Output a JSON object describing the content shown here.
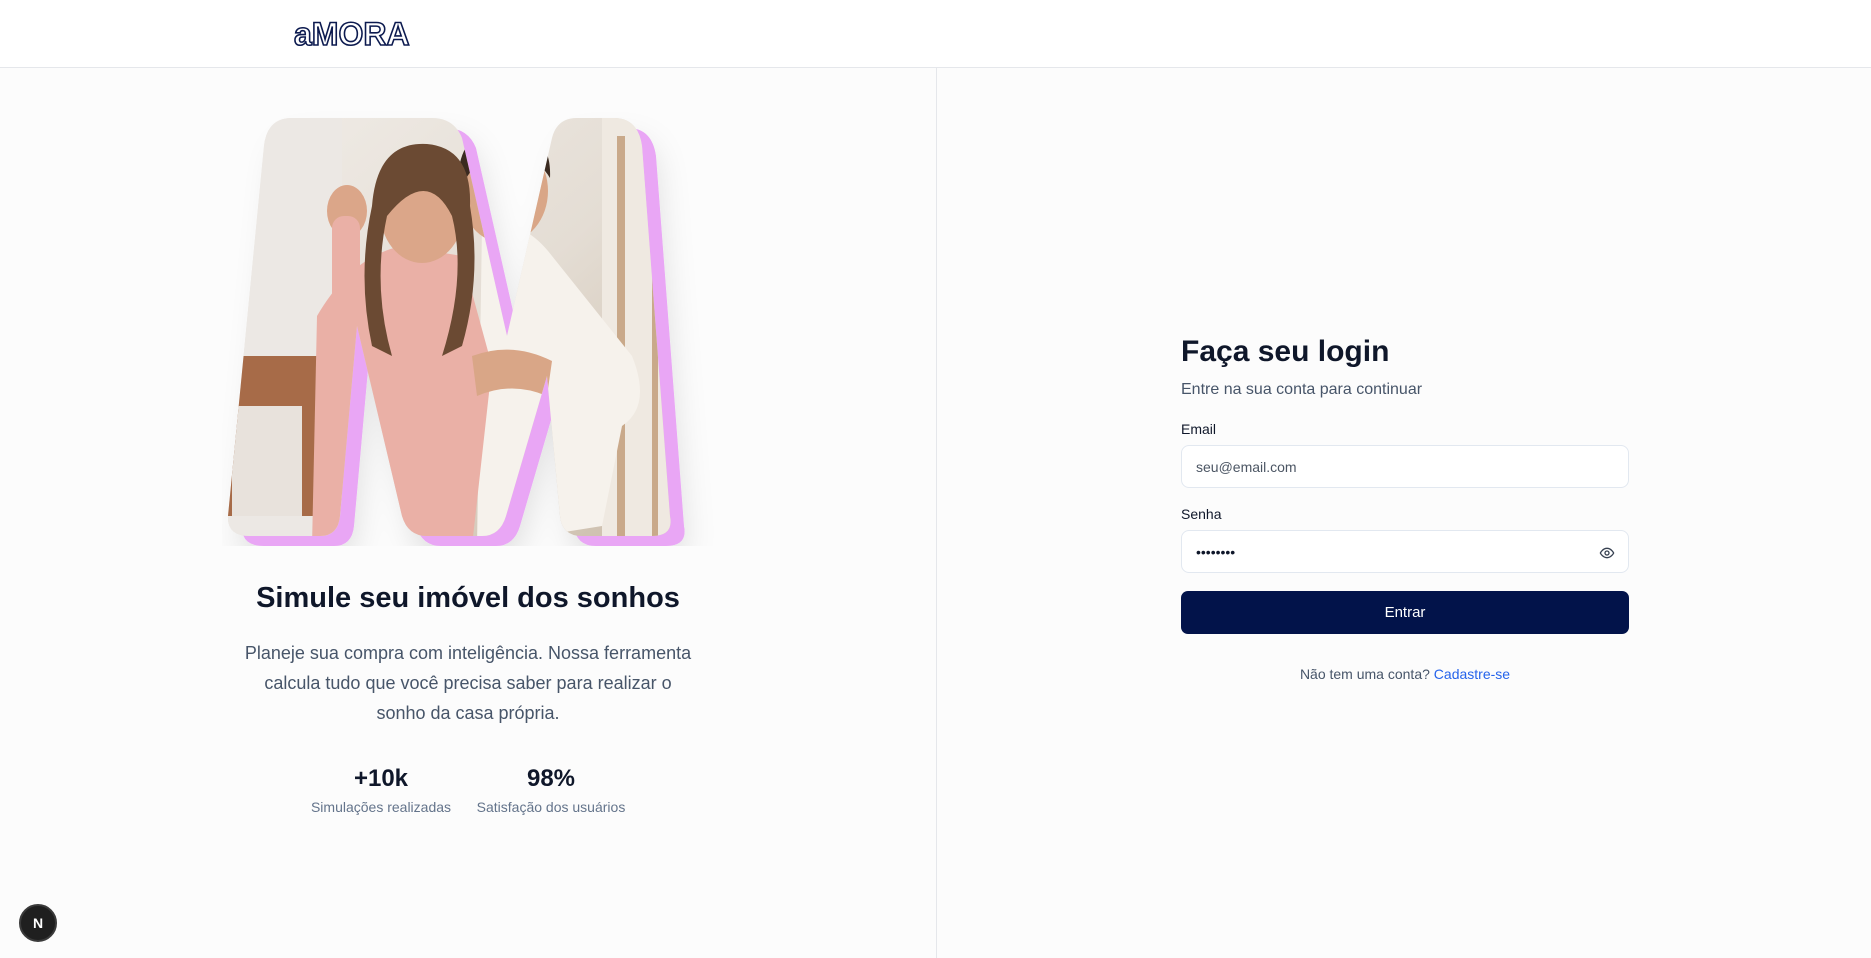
{
  "header": {
    "logo_text": "aMORA"
  },
  "hero": {
    "title": "Simule seu imóvel dos sonhos",
    "description": "Planeje sua compra com inteligência. Nossa ferramenta calcula tudo que você precisa saber para realizar o sonho da casa própria.",
    "image_alt": "Casal sorrindo segurando chaves",
    "stats": [
      {
        "value": "+10k",
        "label": "Simulações realizadas"
      },
      {
        "value": "98%",
        "label": "Satisfação dos usuários"
      }
    ]
  },
  "login": {
    "title": "Faça seu login",
    "subtitle": "Entre na sua conta para continuar",
    "email_label": "Email",
    "email_placeholder": "seu@email.com",
    "email_value": "",
    "password_label": "Senha",
    "password_value": "••••••••",
    "submit_label": "Entrar",
    "signup_prompt": "Não tem uma conta?",
    "signup_link": "Cadastre-se"
  },
  "dev_indicator": {
    "label": "N"
  },
  "colors": {
    "primary": "#02134a",
    "accent_pink": "#e9a6f5",
    "link": "#2563eb",
    "background": "#fcfcfc"
  },
  "icons": [
    "eye-icon"
  ]
}
